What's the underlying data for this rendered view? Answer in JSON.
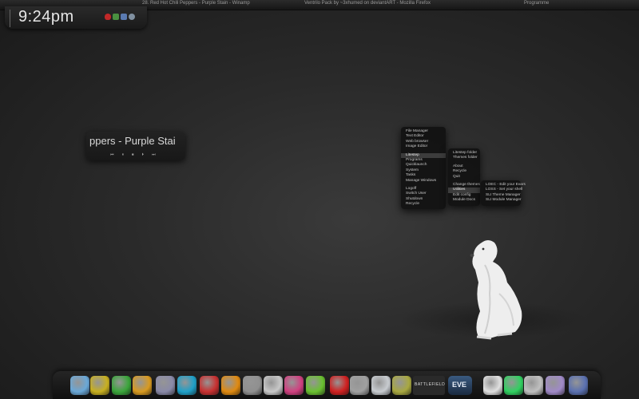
{
  "taskbar": {
    "tasks": [
      "28. Red Hot Chili Peppers - Purple Stain - Winamp",
      "Ventrilo Pack by ~3xhumed on deviantART - Mozilla Firefox",
      "Programme"
    ]
  },
  "clock": {
    "time": "9:24pm"
  },
  "tray_icons": [
    "shield-icon",
    "network-icon",
    "monitor-icon",
    "audio-icon"
  ],
  "winamp": {
    "track_scroll": "ppers - Purple Stai",
    "controls": [
      "⏮",
      "⏸",
      "⏹",
      "⏵",
      "⏭"
    ]
  },
  "main_menu": {
    "items": [
      "File Manager",
      "Text Editor",
      "Web browser",
      "Image Editor",
      "",
      "Litestep",
      "Programs",
      "Quicklaunch",
      "System",
      "Tasks",
      "Manage Windows",
      "",
      "Logoff",
      "Switch User",
      "Shutdown",
      "Recycle"
    ],
    "selected": "Litestep"
  },
  "litestep_menu": {
    "items": [
      "Litestep folder",
      "Themes folder",
      "",
      "About",
      "Recycle",
      "Quit",
      "",
      "Change themes",
      "Utilities",
      "Edit config",
      "Module Docs"
    ],
    "selected": "Utilities"
  },
  "utilities_menu": {
    "items": [
      "LOEC - Edit your Evars",
      "LOSS - Set your shell",
      "SLI Theme Manager",
      "SLI Module Manager"
    ]
  },
  "dock": {
    "icons": [
      {
        "name": "computer-icon",
        "color": "#6aa8d8"
      },
      {
        "name": "yellow-disc-icon",
        "color": "#c8b020"
      },
      {
        "name": "utorrent-icon",
        "color": "#3aa53a"
      },
      {
        "name": "winamp-icon",
        "color": "#d89a20"
      },
      {
        "name": "steam-icon",
        "color": "#8a8aa8"
      },
      {
        "name": "music-note-icon",
        "color": "#1fa0c8"
      },
      {
        "name": "red-app-icon",
        "color": "#c83030"
      },
      {
        "name": "orange-app-icon",
        "color": "#e08a10"
      },
      {
        "name": "floppy-disk-icon",
        "color": "#909090"
      },
      {
        "name": "media-app-icon",
        "color": "#c8c8c8"
      },
      {
        "name": "picasa-icon",
        "color": "#d04080"
      },
      {
        "name": "icq-flower-icon",
        "color": "#6ac030"
      },
      {
        "name": "opera-icon",
        "color": "#d02020"
      },
      {
        "name": "sync-icon",
        "color": "#a0a0a0"
      },
      {
        "name": "recycle-bin-icon",
        "color": "#c8ccd0"
      },
      {
        "name": "battery-icon",
        "color": "#a8a840"
      },
      {
        "name": "battlefield-icon",
        "color": "#8a8a8a"
      },
      {
        "name": "eve-online-icon",
        "color": "#4a7ab0"
      },
      {
        "name": "bag-icon",
        "color": "#e0e0e0"
      },
      {
        "name": "green-gadget-icon",
        "color": "#30d060"
      },
      {
        "name": "chart-gadget-icon",
        "color": "#c0c0c0"
      },
      {
        "name": "purple-tower-icon",
        "color": "#a08ac8"
      },
      {
        "name": "blue-monitor-icon",
        "color": "#5a70b0"
      }
    ],
    "labels": {
      "battlefield": "BATTLEFIELD",
      "eve": "EVE"
    }
  }
}
